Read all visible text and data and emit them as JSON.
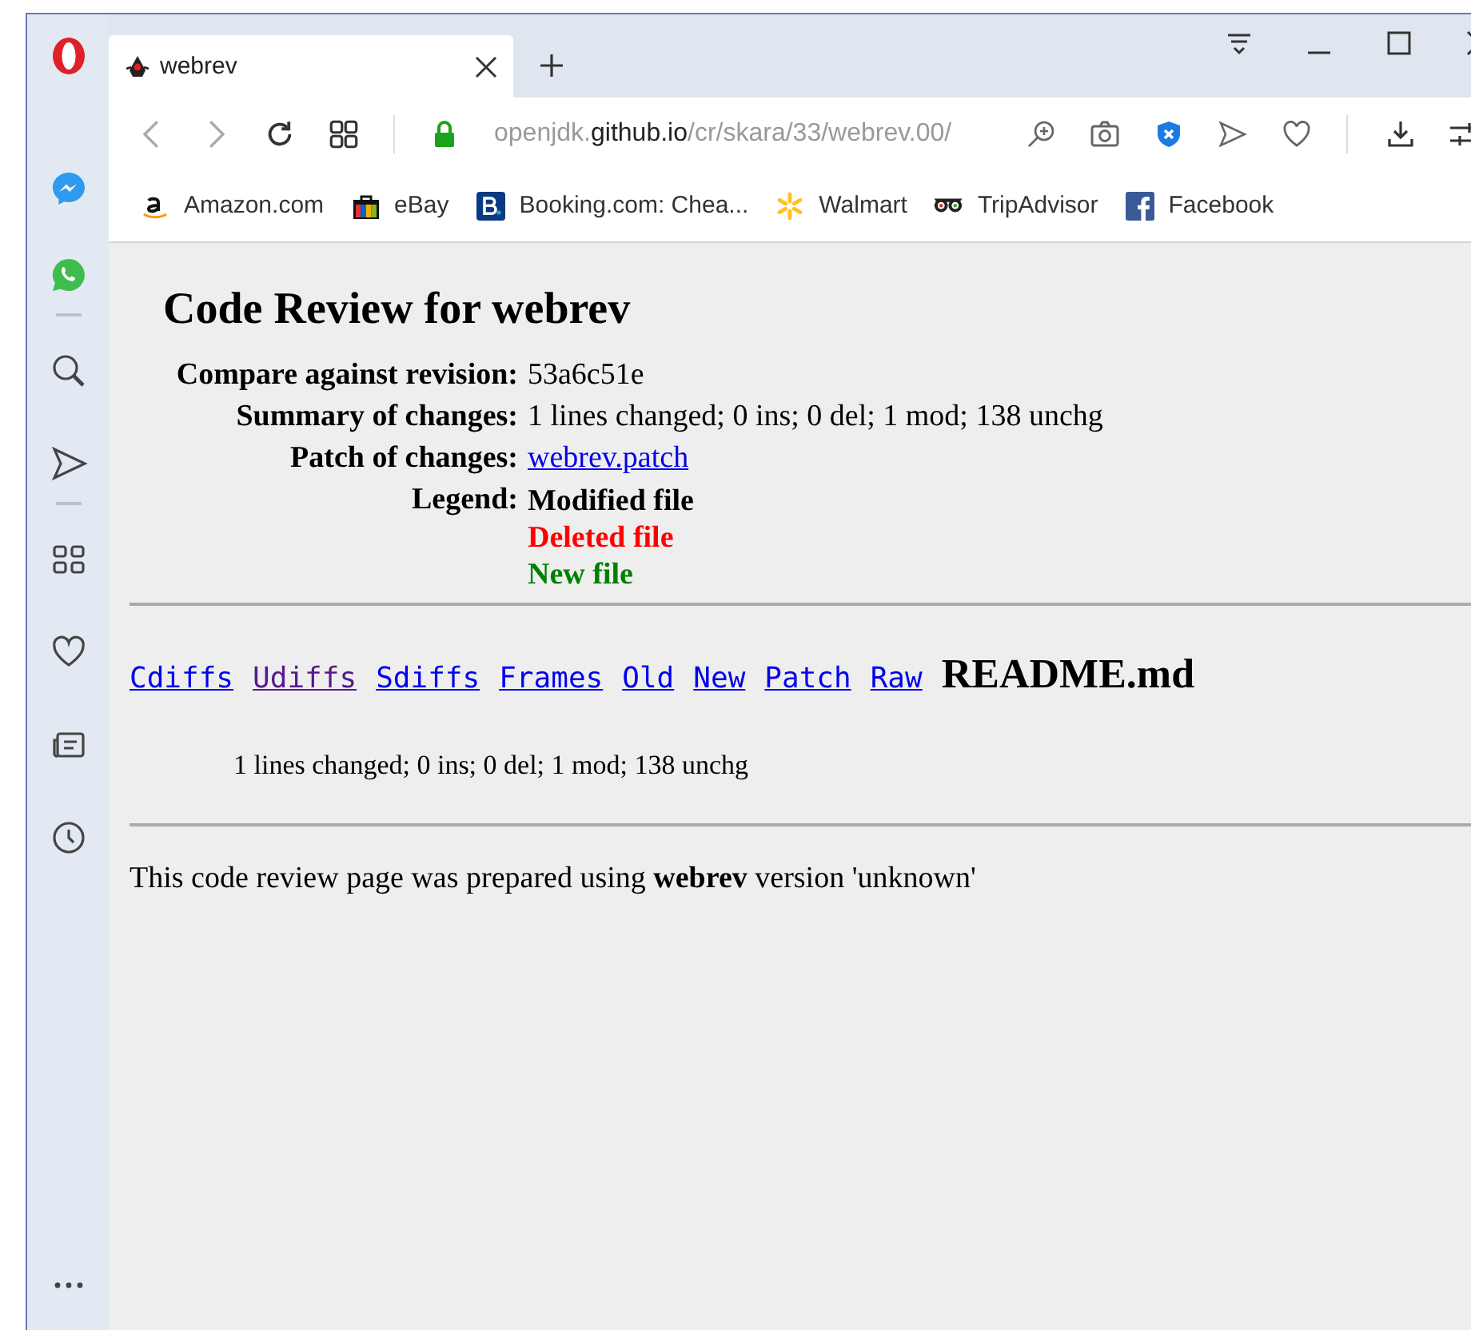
{
  "tab": {
    "title": "webrev"
  },
  "address": {
    "prefix": "openjdk.",
    "domain": "github.io",
    "path": "/cr/skara/33/webrev.00/"
  },
  "bookmarks": [
    {
      "label": "Amazon.com",
      "kind": "amazon"
    },
    {
      "label": "eBay",
      "kind": "ebay"
    },
    {
      "label": "Booking.com: Chea...",
      "kind": "booking"
    },
    {
      "label": "Walmart",
      "kind": "walmart"
    },
    {
      "label": "TripAdvisor",
      "kind": "tripadvisor"
    },
    {
      "label": "Facebook",
      "kind": "facebook"
    }
  ],
  "page": {
    "title": "Code Review for webrev",
    "info": [
      {
        "label": "Compare against revision:",
        "value": "53a6c51e",
        "kind": "text"
      },
      {
        "label": "Summary of changes:",
        "value": "1 lines changed; 0 ins; 0 del; 1 mod; 138 unchg",
        "kind": "text"
      },
      {
        "label": "Patch of changes:",
        "value": "webrev.patch",
        "kind": "link"
      }
    ],
    "legend_label": "Legend:",
    "legend": [
      {
        "label": "Modified file",
        "color": "#000000"
      },
      {
        "label": "Deleted file",
        "color": "#ff0000"
      },
      {
        "label": "New file",
        "color": "#008000"
      }
    ],
    "file_links": [
      {
        "label": "Cdiffs",
        "visited": false
      },
      {
        "label": "Udiffs",
        "visited": true
      },
      {
        "label": "Sdiffs",
        "visited": false
      },
      {
        "label": "Frames",
        "visited": false
      },
      {
        "label": "Old",
        "visited": false
      },
      {
        "label": "New",
        "visited": false
      },
      {
        "label": "Patch",
        "visited": false
      },
      {
        "label": "Raw",
        "visited": false
      }
    ],
    "file_name": "README.md",
    "file_summary": "1 lines changed; 0 ins; 0 del; 1 mod; 138 unchg",
    "footer": "This code review page was prepared using **webrev** version 'unknown'"
  }
}
